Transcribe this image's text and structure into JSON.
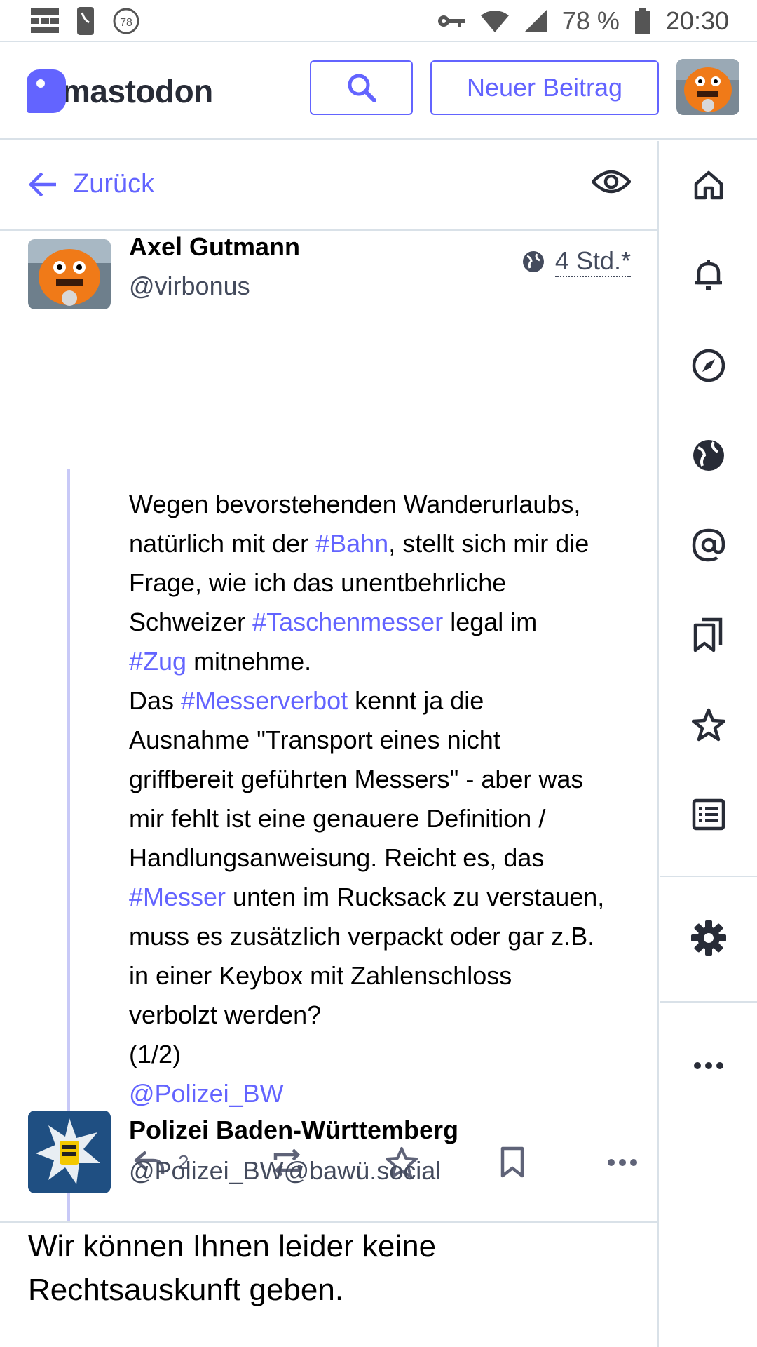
{
  "status_bar": {
    "battery_percent": "78 %",
    "time": "20:30",
    "notification_badge": "78"
  },
  "header": {
    "logo_text": "mastodon",
    "new_post_label": "Neuer Beitrag",
    "search_icon": "search-icon"
  },
  "column": {
    "back_label": "Zurück"
  },
  "status": {
    "display_name": "Axel Gutmann",
    "acct": "@virbonus",
    "visibility_icon": "globe-icon",
    "time": "4 Std.",
    "edited_marker": "*",
    "content": {
      "l1": "Wegen bevorstehenden Wanderurlaubs,",
      "l2a": "natürlich mit der ",
      "l2tag": "#Bahn",
      "l2b": ", stellt sich mir die",
      "l3": "Frage, wie ich das unentbehrliche",
      "l4a": "Schweizer ",
      "l4tag": "#Taschenmesser",
      "l4b": " legal im",
      "l5tag": "#Zug",
      "l5b": " mitnehme.",
      "l6a": "Das ",
      "l6tag": "#Messerverbot",
      "l6b": " kennt ja die",
      "l7": "Ausnahme \"Transport eines nicht",
      "l8": "griffbereit geführten Messers\" - aber was",
      "l9": "mir fehlt ist eine genauere Definition /",
      "l10": "Handlungsanweisung. Reicht es, das",
      "l11tag": "#Messer",
      "l11b": " unten im Rucksack zu verstauen,",
      "l12": "muss es zusätzlich verpackt oder gar z.B.",
      "l13": "in einer Keybox mit Zahlenschloss",
      "l14": "verbolzt werden?",
      "l15": "(1/2)",
      "mention": "@Polizei_BW"
    },
    "reply_count": "2"
  },
  "reply": {
    "display_name": "Polizei Baden-Württemberg",
    "acct": "@Polizei_BW@bawü.social",
    "content_l1": "Wir können Ihnen leider keine",
    "content_l2": "Rechtsauskunft geben."
  },
  "nav": {
    "items": [
      "home-icon",
      "bell-icon",
      "compass-icon",
      "globe-icon",
      "at-icon",
      "bookmarks-icon",
      "star-icon",
      "list-icon",
      "gear-icon",
      "more-icon"
    ]
  },
  "colors": {
    "accent": "#6364ff",
    "thread_line": "#c8c9f7",
    "border": "#d9e1e8",
    "text_secondary": "#444b5d"
  }
}
